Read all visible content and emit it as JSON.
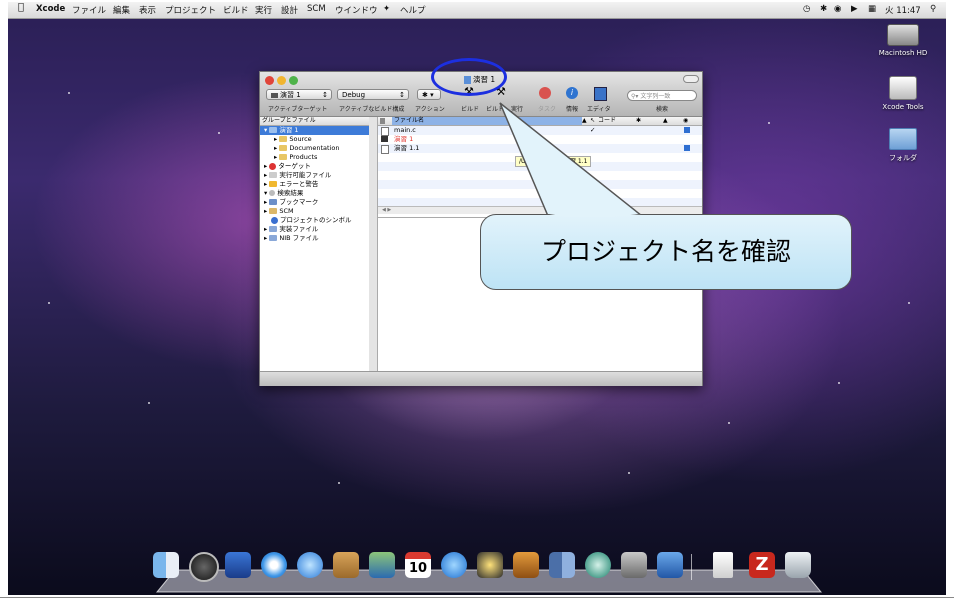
{
  "menubar": {
    "apple_icon": "apple-logo",
    "items": [
      "Xcode",
      "ファイル",
      "編集",
      "表示",
      "プロジェクト",
      "ビルド",
      "実行",
      "設計",
      "SCM",
      "ウインドウ",
      "ヘルプ"
    ],
    "clock": "火 11:47",
    "status_icons": [
      "time-machine-icon",
      "bluetooth-icon",
      "wifi-icon",
      "volume-icon",
      "spaces-icon"
    ]
  },
  "desktop_icons": [
    {
      "label": "Macintosh HD",
      "icon": "hard-drive-icon"
    },
    {
      "label": "Xcode Tools",
      "icon": "drive-icon"
    },
    {
      "label": "フォルダ",
      "icon": "folder-icon"
    }
  ],
  "window": {
    "title": "演習 1",
    "toolbar": {
      "target_popup": "演習 1",
      "config_popup": "Debug",
      "action_popup": "✱ ▾",
      "labels": [
        "アクティブターゲット",
        "アクティブなビルド構成",
        "アクション",
        "ビルド",
        "ビルド",
        "実行",
        "タスク",
        "情報",
        "エディタ",
        "検索"
      ],
      "search_placeholder": "文字列一致"
    },
    "sidebar": {
      "header": "グループとファイル",
      "items": [
        {
          "label": "演習 1",
          "level": 0,
          "selected": true
        },
        {
          "label": "Source",
          "level": 1
        },
        {
          "label": "Documentation",
          "level": 1
        },
        {
          "label": "Products",
          "level": 1
        },
        {
          "label": "ターゲット",
          "level": 0
        },
        {
          "label": "実行可能ファイル",
          "level": 0
        },
        {
          "label": "エラーと警告",
          "level": 0
        },
        {
          "label": "検索結果",
          "level": 0
        },
        {
          "label": "ブックマーク",
          "level": 0
        },
        {
          "label": "SCM",
          "level": 0
        },
        {
          "label": "プロジェクトのシンボル",
          "level": 0
        },
        {
          "label": "実装ファイル",
          "level": 0
        },
        {
          "label": "NIB ファイル",
          "level": 0
        }
      ]
    },
    "file_list": {
      "columns": [
        "ファイル名",
        "コード"
      ],
      "rows": [
        {
          "name": "main.c",
          "color": "#000000",
          "check": "✓"
        },
        {
          "name": "演習 1",
          "color": "#e0302a",
          "check": ""
        },
        {
          "name": "演習 1.1",
          "color": "#000000",
          "check": ""
        }
      ]
    },
    "tooltip": "/U...ple/演習 1 /演習 1.1"
  },
  "callout": {
    "text": "プロジェクト名を確認",
    "colors": {
      "oval": "#1c2fe0",
      "bubble_top": "#e2f3fb",
      "bubble_bottom": "#bde3f5"
    }
  },
  "dock": {
    "icons": [
      "finder-icon",
      "dashboard-icon",
      "mail-icon",
      "safari-icon",
      "ichat-icon",
      "address-book-icon",
      "iphoto-icon",
      "ical-icon",
      "itunes-icon",
      "imovie-icon",
      "garageband-icon",
      "spaces-icon",
      "time-machine-icon",
      "system-preferences-icon",
      "xcode-icon",
      "document-icon",
      "filezilla-icon",
      "trash-icon"
    ],
    "ical_date": "10"
  }
}
